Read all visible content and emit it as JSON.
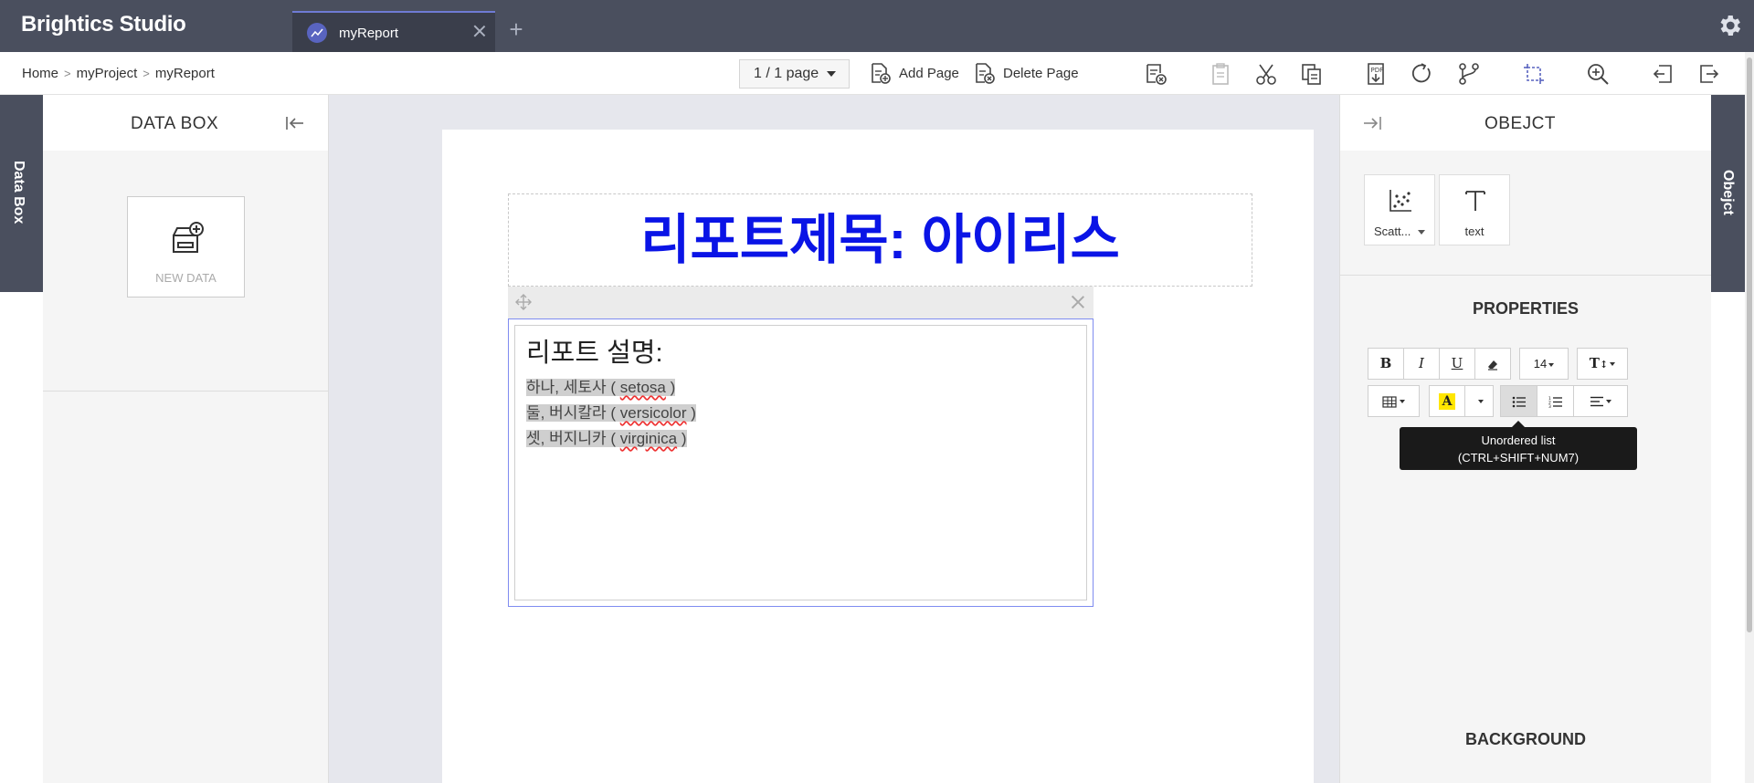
{
  "app": {
    "title": "Brightics Studio"
  },
  "tabs": [
    {
      "label": "myReport"
    }
  ],
  "breadcrumb": [
    "Home",
    "myProject",
    "myReport"
  ],
  "toolbar": {
    "page_indicator": "1 / 1 page",
    "add_page_label": "Add Page",
    "delete_page_label": "Delete Page"
  },
  "left_rail": {
    "label": "Data Box"
  },
  "databox": {
    "title": "DATA BOX",
    "new_data_label": "NEW DATA"
  },
  "report": {
    "title": "리포트제목: 아이리스",
    "description_heading": "리포트 설명:",
    "lines": [
      {
        "prefix": "하나, 세토사 ( ",
        "word": "setosa",
        "suffix": " )"
      },
      {
        "prefix": "둘, 버시칼라 ( ",
        "word": "versicolor",
        "suffix": " )"
      },
      {
        "prefix": "셋, 버지니카 ( ",
        "word": "virginica",
        "suffix": " )"
      }
    ]
  },
  "object_panel": {
    "title": "OBEJCT",
    "objects": [
      {
        "label": "Scatt..."
      },
      {
        "label": "text"
      }
    ],
    "properties_title": "PROPERTIES",
    "font_size": "14",
    "tooltip_line1": "Unordered list",
    "tooltip_line2": "(CTRL+SHIFT+NUM7)",
    "background_title": "BACKGROUND"
  },
  "right_rail": {
    "label": "Obejct"
  },
  "colors": {
    "title_blue": "#0a14e6",
    "header_bg": "#4a4f5e",
    "accent": "#6f7bd4"
  }
}
